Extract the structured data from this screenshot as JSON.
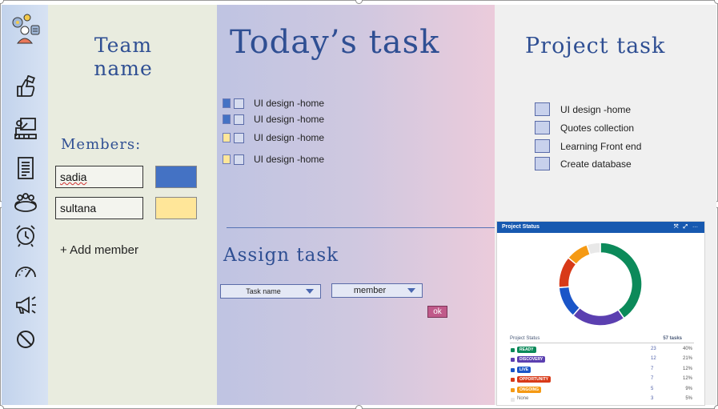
{
  "rail": {
    "icons": [
      "team-logo",
      "thumbs-up",
      "presentation",
      "document-list",
      "group",
      "alarm-clock",
      "speedometer",
      "megaphone",
      "block"
    ]
  },
  "team": {
    "title": "Team name",
    "members_label": "Members:",
    "members": [
      {
        "name": "sadia",
        "color": "#4472c4"
      },
      {
        "name": "sultana",
        "color": "#ffe699"
      }
    ],
    "add_member_label": "+ Add member"
  },
  "today": {
    "title": "Today’s task",
    "tasks": [
      {
        "label": "UI design -home",
        "mark_color": "#4472c4"
      },
      {
        "label": "UI design -home",
        "mark_color": "#4472c4"
      },
      {
        "label": "UI design -home",
        "mark_color": "#ffe699"
      },
      {
        "label": "UI design -home",
        "mark_color": "#ffe699"
      }
    ],
    "assign_title": "Assign task",
    "task_select": "Task name",
    "member_select": "member",
    "ok_label": "ok"
  },
  "project": {
    "title": "Project task",
    "tasks": [
      "UI design -home",
      "Quotes collection",
      "Learning Front end",
      "Create database"
    ]
  },
  "status_widget": {
    "header": "Project Status",
    "header_tools": "⤧ ⤢ ⋯",
    "table_title": "Project Status",
    "total": "57 tasks",
    "rows": [
      {
        "label": "READY",
        "count": "23",
        "percent": "40%",
        "color": "#0c8a5a",
        "badge": true
      },
      {
        "label": "DISCOVERY",
        "count": "12",
        "percent": "21%",
        "color": "#5b3fb0",
        "badge": true
      },
      {
        "label": "LIVE",
        "count": "7",
        "percent": "12%",
        "color": "#1a55c8",
        "badge": true
      },
      {
        "label": "OPPORTUNITY",
        "count": "7",
        "percent": "12%",
        "color": "#d83a18",
        "badge": true
      },
      {
        "label": "ONGOING",
        "count": "5",
        "percent": "9%",
        "color": "#f59a14",
        "badge": true
      },
      {
        "label": "None",
        "count": "3",
        "percent": "5%",
        "color": "#e8e8e8",
        "badge": false
      }
    ]
  },
  "chart_data": {
    "type": "pie",
    "title": "Project Status",
    "categories": [
      "READY",
      "DISCOVERY",
      "LIVE",
      "OPPORTUNITY",
      "ONGOING",
      "None"
    ],
    "values": [
      23,
      12,
      7,
      7,
      5,
      3
    ],
    "colors": [
      "#0c8a5a",
      "#5b3fb0",
      "#1a55c8",
      "#d83a18",
      "#f59a14",
      "#e8e8e8"
    ],
    "donut": true
  }
}
